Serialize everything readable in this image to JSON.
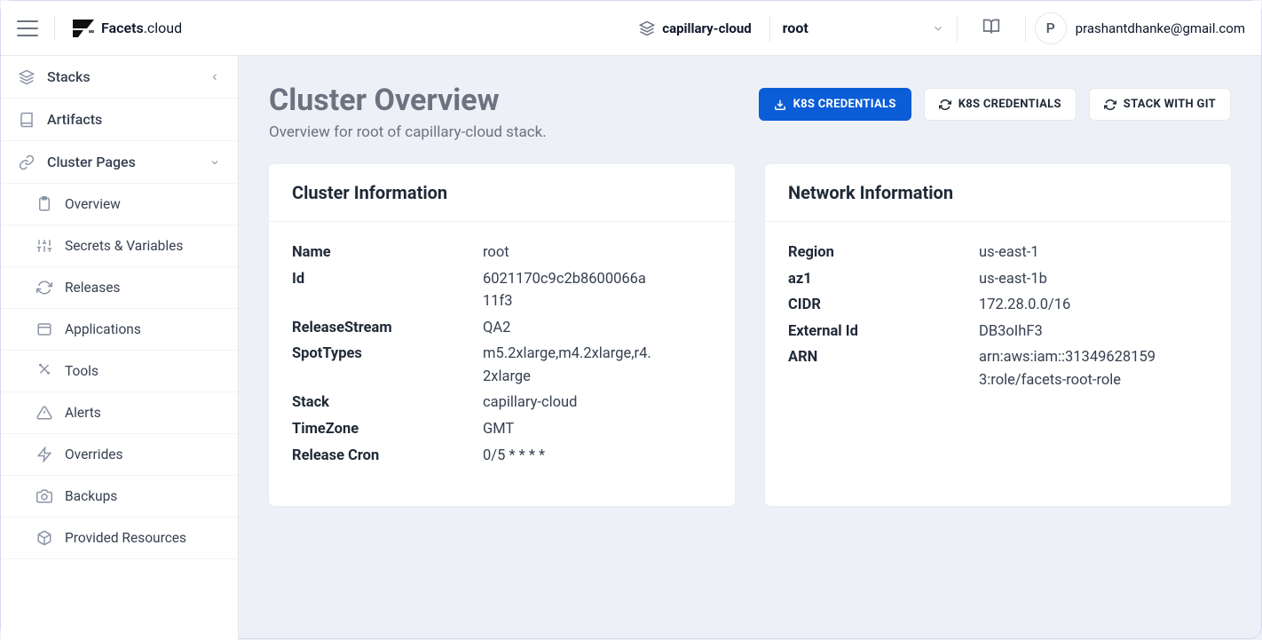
{
  "topbar": {
    "logo_brand": "Facets",
    "logo_suffix": ".cloud",
    "stack_label": "capillary-cloud",
    "root_label": "root",
    "avatar_initial": "P",
    "user_email": "prashantdhanke@gmail.com"
  },
  "sidebar": {
    "stacks": "Stacks",
    "artifacts": "Artifacts",
    "cluster_pages": "Cluster Pages",
    "items": {
      "overview": "Overview",
      "secrets": "Secrets & Variables",
      "releases": "Releases",
      "applications": "Applications",
      "tools": "Tools",
      "alerts": "Alerts",
      "overrides": "Overrides",
      "backups": "Backups",
      "provided": "Provided Resources"
    }
  },
  "page": {
    "title": "Cluster Overview",
    "subtitle": "Overview for root of capillary-cloud stack.",
    "btn_k8s_download": "K8S CREDENTIALS",
    "btn_k8s_refresh": "K8S CREDENTIALS",
    "btn_stack_git": "STACK WITH GIT"
  },
  "cluster_info": {
    "title": "Cluster Information",
    "rows": {
      "name_k": "Name",
      "name_v": "root",
      "id_k": "Id",
      "id_v": "6021170c9c2b8600066a11f3",
      "rs_k": "ReleaseStream",
      "rs_v": "QA2",
      "st_k": "SpotTypes",
      "st_v": "m5.2xlarge,m4.2xlarge,r4.2xlarge",
      "stack_k": "Stack",
      "stack_v": "capillary-cloud",
      "tz_k": "TimeZone",
      "tz_v": "GMT",
      "cron_k": "Release Cron",
      "cron_v": "0/5 * * * *"
    }
  },
  "network_info": {
    "title": "Network Information",
    "rows": {
      "region_k": "Region",
      "region_v": "us-east-1",
      "az_k": "az1",
      "az_v": "us-east-1b",
      "cidr_k": "CIDR",
      "cidr_v": "172.28.0.0/16",
      "ext_k": "External Id",
      "ext_v": "DB3oIhF3",
      "arn_k": "ARN",
      "arn_v": "arn:aws:iam::313496281593:role/facets-root-role"
    }
  }
}
